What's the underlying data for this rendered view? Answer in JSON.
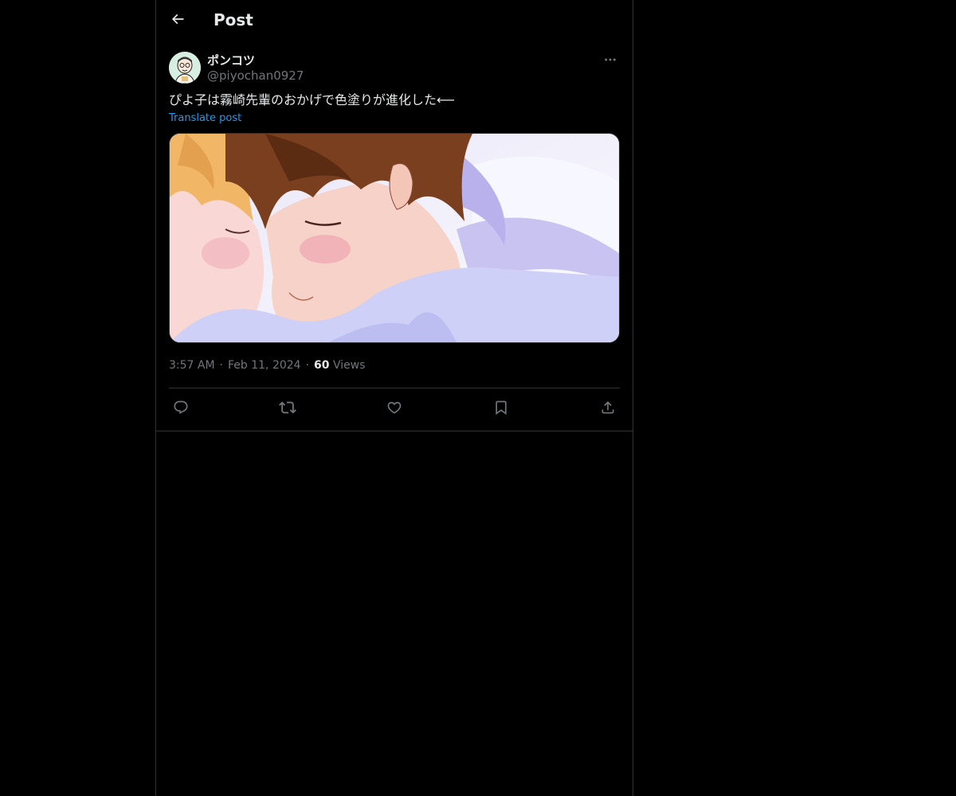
{
  "header": {
    "title": "Post",
    "back_icon": "arrow-left-icon"
  },
  "post": {
    "author": {
      "display_name": "ポンコツ",
      "handle": "@piyochan0927"
    },
    "text": "ぴよ子は霧崎先輩のおかげで色塗りが進化した⟵",
    "translate_label": "Translate post",
    "timestamp": {
      "time": "3:57 AM",
      "date": "Feb 11, 2024"
    },
    "views": {
      "count": "60",
      "label": "Views"
    },
    "actions": [
      "reply-icon",
      "repost-icon",
      "like-icon",
      "bookmark-icon",
      "share-icon"
    ]
  },
  "colors": {
    "background": "#000000",
    "text_primary": "#e7e9ea",
    "text_secondary": "#71767b",
    "accent": "#1d9bf0",
    "border": "#2f3336"
  }
}
